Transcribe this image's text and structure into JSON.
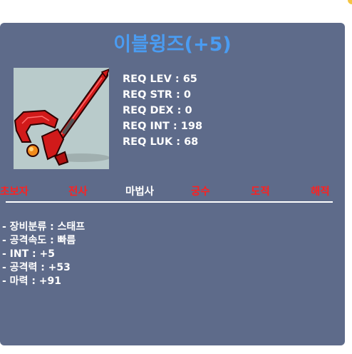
{
  "item": {
    "name": "이블윙즈(+5)",
    "icon": "red-staff-weapon-icon"
  },
  "requirements": [
    "REQ LEV : 65",
    "REQ STR : 0",
    "REQ DEX : 0",
    "REQ INT : 198",
    "REQ LUK : 68"
  ],
  "jobs": [
    {
      "label": "초보자",
      "available": false
    },
    {
      "label": "전사",
      "available": false
    },
    {
      "label": "마법사",
      "available": true
    },
    {
      "label": "궁수",
      "available": false
    },
    {
      "label": "도적",
      "available": false
    },
    {
      "label": "해적",
      "available": false
    }
  ],
  "stats": [
    "- 장비분류 : 스태프",
    "- 공격속도 : 빠름",
    "- INT : +5",
    "- 공격력 : +53",
    "- 마력 : +91"
  ],
  "colors": {
    "panel": "#5e6b8a",
    "title": "#4a9cf2",
    "available_job": "#ffffff",
    "unavailable_job": "#ff2020"
  }
}
